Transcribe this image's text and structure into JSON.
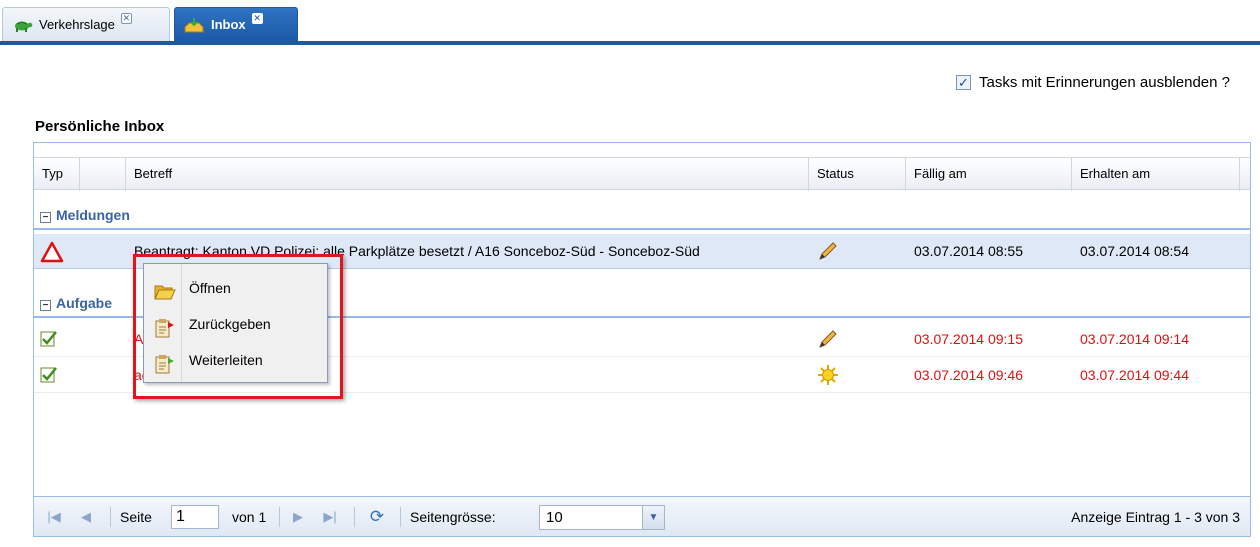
{
  "tabs": [
    {
      "label": "Verkehrslage",
      "icon": "turtle-icon",
      "active": false
    },
    {
      "label": "Inbox",
      "icon": "inbox-tray-icon",
      "active": true
    }
  ],
  "reminder_checkbox": {
    "label": "Tasks mit Erinnerungen ausblenden ?",
    "checked": true
  },
  "section_title": "Persönliche Inbox",
  "grid": {
    "columns": [
      "Typ",
      "Betreff",
      "Status",
      "Fällig am",
      "Erhalten am"
    ],
    "groups": [
      {
        "label": "Meldungen",
        "rows": [
          {
            "type_icon": "warning-triangle-icon",
            "subject": "Beantragt: Kanton.VD.Polizei: alle Parkplätze besetzt / A16 Sonceboz-Süd - Sonceboz-Süd",
            "status_icon": "pencil-icon",
            "due": "03.07.2014 08:55",
            "received": "03.07.2014 08:54",
            "overdue": false,
            "selected": true
          }
        ]
      },
      {
        "label": "Aufgabe",
        "rows": [
          {
            "type_icon": "task-check-icon",
            "subject": "A",
            "status_icon": "pencil-icon",
            "due": "03.07.2014 09:15",
            "received": "03.07.2014 09:14",
            "overdue": true,
            "selected": false
          },
          {
            "type_icon": "task-check-icon",
            "subject": "aqasdada",
            "status_icon": "sun-icon",
            "due": "03.07.2014 09:46",
            "received": "03.07.2014 09:44",
            "overdue": true,
            "selected": false
          }
        ]
      }
    ]
  },
  "context_menu": [
    {
      "label": "Öffnen",
      "icon": "folder-open-icon"
    },
    {
      "label": "Zurückgeben",
      "icon": "return-document-icon"
    },
    {
      "label": "Weiterleiten",
      "icon": "forward-document-icon"
    }
  ],
  "pager": {
    "page_label": "Seite",
    "page_value": "1",
    "of_label": "von 1",
    "page_size_label": "Seitengrösse:",
    "page_size_value": "10",
    "display_info": "Anzeige Eintrag 1 - 3 von 3"
  },
  "colors": {
    "accent": "#1e5aa0",
    "group_text": "#3a64a4",
    "overdue": "#e01010",
    "highlight_border": "#e3151c",
    "selected_row": "#dfe8f6"
  }
}
